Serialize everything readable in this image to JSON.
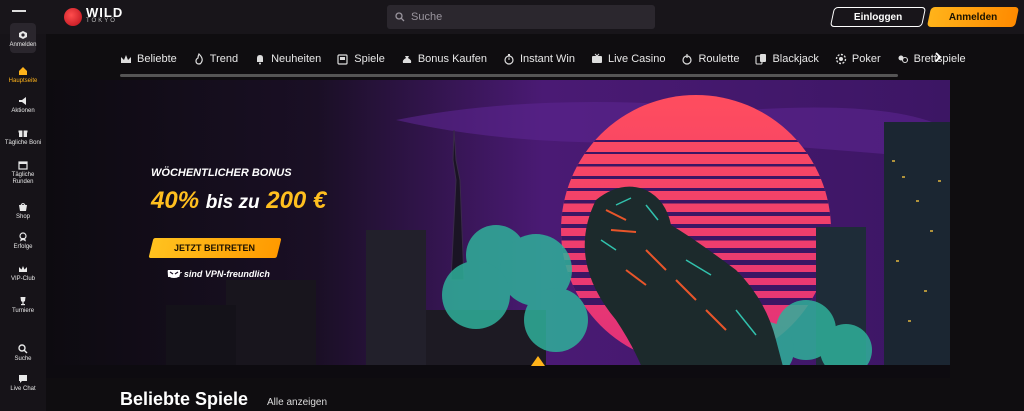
{
  "header": {
    "logo_main": "WILD",
    "logo_sub": "TOKYO",
    "search_placeholder": "Suche",
    "login_label": "Einloggen",
    "signup_label": "Anmelden"
  },
  "sidebar": {
    "items": [
      {
        "label": "Anmelden",
        "icon": "user-plus-icon"
      },
      {
        "label": "Hauptseite",
        "icon": "home-icon",
        "active": true
      },
      {
        "label": "Aktionen",
        "icon": "megaphone-icon"
      },
      {
        "label": "Tägliche Boni",
        "icon": "gift-icon"
      },
      {
        "label": "Tägliche Runden",
        "icon": "calendar-icon"
      },
      {
        "label": "Shop",
        "icon": "shop-icon"
      },
      {
        "label": "Erfolge",
        "icon": "medal-icon"
      },
      {
        "label": "VIP-Club",
        "icon": "crown-icon"
      },
      {
        "label": "Turniere",
        "icon": "trophy-icon"
      },
      {
        "label": "Suche",
        "icon": "search-icon"
      },
      {
        "label": "Live Chat",
        "icon": "chat-icon"
      }
    ]
  },
  "categories": [
    {
      "label": "Beliebte",
      "icon": "crown-icon"
    },
    {
      "label": "Trend",
      "icon": "flame-icon"
    },
    {
      "label": "Neuheiten",
      "icon": "bell-icon"
    },
    {
      "label": "Spiele",
      "icon": "slot-machine-icon"
    },
    {
      "label": "Bonus Kaufen",
      "icon": "money-bag-icon"
    },
    {
      "label": "Instant Win",
      "icon": "stopwatch-icon"
    },
    {
      "label": "Live Casino",
      "icon": "live-tv-icon"
    },
    {
      "label": "Roulette",
      "icon": "roulette-icon"
    },
    {
      "label": "Blackjack",
      "icon": "cards-icon"
    },
    {
      "label": "Poker",
      "icon": "chips-icon"
    },
    {
      "label": "Brettspiele",
      "icon": "board-game-icon"
    }
  ],
  "hero": {
    "kicker": "WÖCHENTLICHER BONUS",
    "offer_pct": "40%",
    "offer_mid": "bis zu",
    "offer_amount": "200 €",
    "cta_label": "JETZT BEITRETEN",
    "vpn_text": "Wir sind VPN-freundlich"
  },
  "section": {
    "title": "Beliebte Spiele",
    "link": "Alle anzeigen"
  },
  "colors": {
    "accent": "#ffb31a",
    "background": "#0f0d10",
    "sun": "#ff4d5e"
  }
}
